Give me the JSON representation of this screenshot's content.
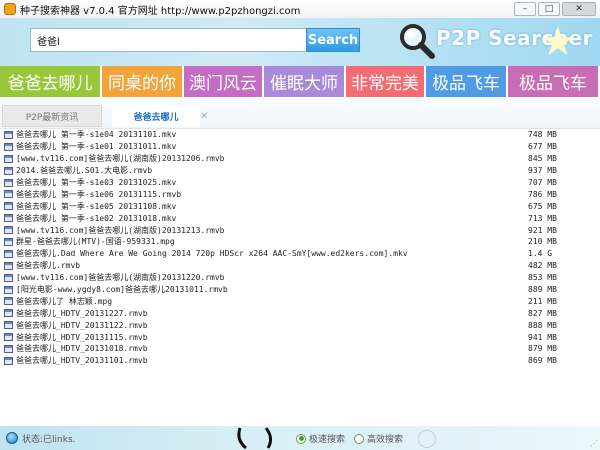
{
  "window": {
    "title": "种子搜索神器 v7.0.4 官方网址 http://www.p2pzhongzi.com",
    "icon": "app-icon",
    "controls": [
      "minimize-icon",
      "maximize-icon",
      "close-icon"
    ]
  },
  "search": {
    "value": "爸爸l",
    "button_label": "Search"
  },
  "logo": {
    "text": "P2P Searcher",
    "icon": "magnifier-icon"
  },
  "hot_keywords": [
    {
      "label": "爸爸去哪儿",
      "color": "#98c83a"
    },
    {
      "label": "同桌的你",
      "color": "#f2a33b"
    },
    {
      "label": "澳门风云",
      "color": "#c56cc5"
    },
    {
      "label": "催眠大师",
      "color": "#a88ad9"
    },
    {
      "label": "非常完美",
      "color": "#f26c73"
    },
    {
      "label": "极品飞车",
      "color": "#4f9be6"
    },
    {
      "label": "极品飞车",
      "color": "#c86cb4"
    }
  ],
  "tabs": [
    {
      "label": "P2P最新资讯",
      "active": false
    },
    {
      "label": "爸爸去哪儿",
      "active": true
    }
  ],
  "files": [
    {
      "name": "爸爸去哪儿 第一季-s1e04 20131101.mkv",
      "size": "748 MB"
    },
    {
      "name": "爸爸去哪儿 第一季-s1e01 20131011.mkv",
      "size": "677 MB"
    },
    {
      "name": "[www.tv116.com]爸爸去哪儿(湖南版)20131206.rmvb",
      "size": "845 MB"
    },
    {
      "name": "2014.爸爸去哪儿.S01.大电影.rmvb",
      "size": "937 MB"
    },
    {
      "name": "爸爸去哪儿 第一季-s1e03 20131025.mkv",
      "size": "707 MB"
    },
    {
      "name": "爸爸去哪儿 第一季-s1e06 20131115.rmvb",
      "size": "786 MB"
    },
    {
      "name": "爸爸去哪儿 第一季-s1e05 20131108.mkv",
      "size": "675 MB"
    },
    {
      "name": "爸爸去哪儿 第一季-s1e02 20131018.mkv",
      "size": "713 MB"
    },
    {
      "name": "[www.tv116.com]爸爸去哪儿(湖南版)20131213.rmvb",
      "size": "921 MB"
    },
    {
      "name": "群星-爸爸去哪儿(MTV)-国语-959331.mpg",
      "size": "210 MB"
    },
    {
      "name": "爸爸去哪儿.Dad Where Are We Going 2014 720p HDScr x264 AAC-SmY[www.ed2kers.com].mkv",
      "size": "1.4 G"
    },
    {
      "name": "爸爸去哪儿.rmvb",
      "size": "482 MB"
    },
    {
      "name": "[www.tv116.com]爸爸去哪儿(湖南版)20131220.rmvb",
      "size": "853 MB"
    },
    {
      "name": "[阳光电影-www.ygdy8.com]爸爸去哪儿20131011.rmvb",
      "size": "889 MB"
    },
    {
      "name": "爸爸去哪儿了 林志颖.mpg",
      "size": "211 MB"
    },
    {
      "name": "爸爸去哪儿_HDTV_20131227.rmvb",
      "size": "827 MB"
    },
    {
      "name": "爸爸去哪儿_HDTV_20131122.rmvb",
      "size": "888 MB"
    },
    {
      "name": "爸爸去哪儿_HDTV_20131115.rmvb",
      "size": "941 MB"
    },
    {
      "name": "爸爸去哪儿_HDTV_20131018.rmvb",
      "size": "879 MB"
    },
    {
      "name": "爸爸去哪儿_HDTV_20131101.rmvb",
      "size": "869 MB"
    }
  ],
  "status": {
    "text": "状态:已links.",
    "options": [
      {
        "label": "极速搜索",
        "selected": true
      },
      {
        "label": "高效搜索",
        "selected": false
      }
    ]
  }
}
